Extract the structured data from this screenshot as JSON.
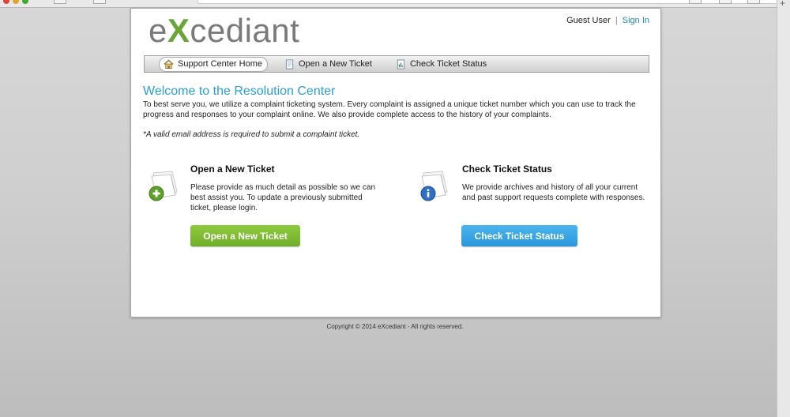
{
  "header": {
    "logo_text": "eXcediant",
    "user_label": "Guest User",
    "separator": "|",
    "signin_label": "Sign In"
  },
  "nav": {
    "items": [
      {
        "label": "Support Center Home",
        "icon": "home-icon",
        "active": true
      },
      {
        "label": "Open a New Ticket",
        "icon": "document-icon",
        "active": false
      },
      {
        "label": "Check Ticket Status",
        "icon": "status-icon",
        "active": false
      }
    ]
  },
  "main": {
    "title": "Welcome to the Resolution Center",
    "intro": "To best serve you, we utilize a complaint ticketing system. Every complaint is assigned a unique ticket number which you can use to track the progress and responses to your complaint online. We also provide complete access to the history of your complaints.",
    "note": "*A valid email address is required to submit a complaint ticket.",
    "open_ticket": {
      "heading": "Open a New Ticket",
      "text": "Please provide as much detail as possible so we can best assist you. To update a previously submitted ticket, please login.",
      "button": "Open a New Ticket",
      "icon": "new-ticket-icon"
    },
    "check_status": {
      "heading": "Check Ticket Status",
      "text": "We provide archives and history of all your current and past support requests complete with responses.",
      "button": "Check Ticket Status",
      "icon": "info-ticket-icon"
    }
  },
  "footer": {
    "copyright": "Copyright © 2014 eXcediant - All rights reserved."
  },
  "colors": {
    "accent_blue": "#2a9fd6",
    "button_green": "#7ab932",
    "button_blue": "#34a3e3",
    "logo_x": "#6aa53a"
  }
}
